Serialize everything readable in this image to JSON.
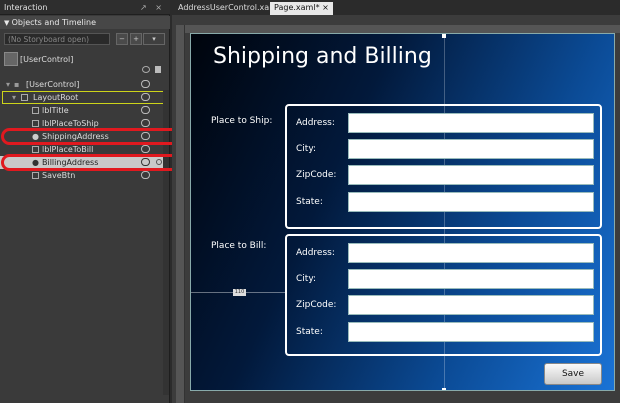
{
  "left_panel": {
    "header": "Interaction",
    "header_icons": "↗ ×",
    "subheader": "Objects and Timeline",
    "storyboard_placeholder": "(No Storyboard open)",
    "storyboard_btn1": "−",
    "storyboard_btn2": "+",
    "scope": "[UserControl]",
    "tree": [
      {
        "label": "[UserControl]"
      },
      {
        "label": "LayoutRoot"
      },
      {
        "label": "lblTitle"
      },
      {
        "label": "lblPlaceToShip"
      },
      {
        "label": "ShippingAddress"
      },
      {
        "label": "lblPlaceToBill"
      },
      {
        "label": "BillingAddress"
      },
      {
        "label": "SaveBtn"
      }
    ]
  },
  "tabs": [
    {
      "label": "AddressUserControl.xaml",
      "close": "×"
    },
    {
      "label": "Page.xaml*",
      "close": "×"
    }
  ],
  "page": {
    "title": "Shipping and Billing",
    "place_to_ship": "Place to Ship:",
    "place_to_bill": "Place to Bill:",
    "ship_fields": [
      "Address:",
      "City:",
      "ZipCode:",
      "State:"
    ],
    "bill_fields": [
      "Address:",
      "City:",
      "ZipCode:",
      "State:"
    ],
    "save": "Save",
    "measure": "110"
  }
}
